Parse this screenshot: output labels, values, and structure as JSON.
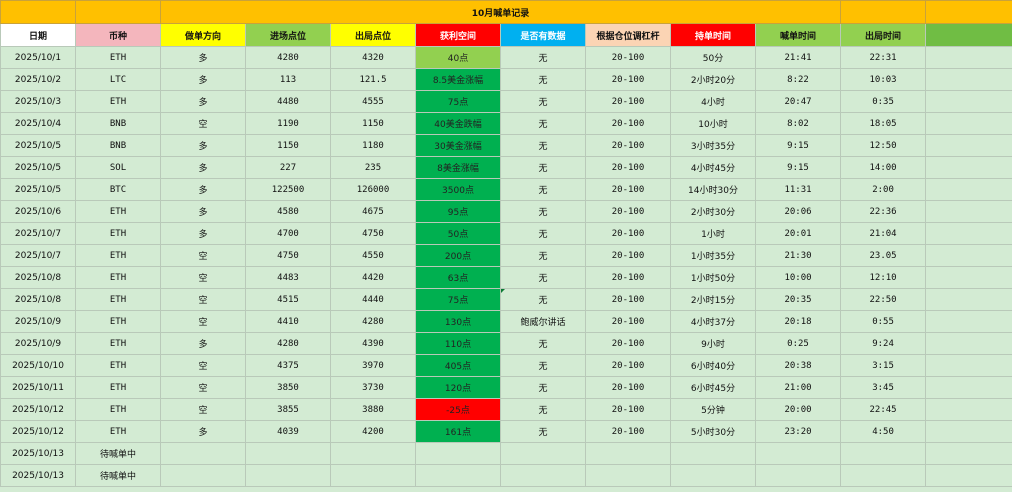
{
  "sheet": {
    "title": "10月喊单记录",
    "colors": {
      "page_bg": "#d3ebd3",
      "title_bg": "#ffc000",
      "profit_green": "#00b050",
      "profit_light_green": "#92d050",
      "loss_red": "#ff0000"
    },
    "headers": [
      {
        "label": "日期",
        "bg": "#ffffff",
        "color": "#111111"
      },
      {
        "label": "币种",
        "bg": "#f4b6bd",
        "color": "#111111"
      },
      {
        "label": "做单方向",
        "bg": "#ffff00",
        "color": "#111111"
      },
      {
        "label": "进场点位",
        "bg": "#92d050",
        "color": "#111111"
      },
      {
        "label": "出局点位",
        "bg": "#ffff00",
        "color": "#111111"
      },
      {
        "label": "获利空间",
        "bg": "#ff0000",
        "color": "#ffffff"
      },
      {
        "label": "是否有数据",
        "bg": "#00b0f0",
        "color": "#ffffff"
      },
      {
        "label": "根据仓位调杠杆",
        "bg": "#fbd4b4",
        "color": "#111111"
      },
      {
        "label": "持单时间",
        "bg": "#ff0000",
        "color": "#ffffff"
      },
      {
        "label": "喊单时间",
        "bg": "#92d050",
        "color": "#111111"
      },
      {
        "label": "出局时间",
        "bg": "#92d050",
        "color": "#111111"
      },
      {
        "label": "",
        "bg": "#70bd44",
        "color": "#111111"
      }
    ],
    "rows": [
      {
        "date": "2025/10/1",
        "coin": "ETH",
        "direction": "多",
        "entry": "4280",
        "exit": "4320",
        "profit": "40点",
        "profit_bg": "#92d050",
        "data": "无",
        "leverage": "20-100",
        "hold": "50分",
        "call_time": "21:41",
        "out_time": "22:31"
      },
      {
        "date": "2025/10/2",
        "coin": "LTC",
        "direction": "多",
        "entry": "113",
        "exit": "121.5",
        "profit": "8.5美金涨幅",
        "profit_bg": "#00b050",
        "data": "无",
        "leverage": "20-100",
        "hold": "2小时20分",
        "call_time": "8:22",
        "out_time": "10:03"
      },
      {
        "date": "2025/10/3",
        "coin": "ETH",
        "direction": "多",
        "entry": "4480",
        "exit": "4555",
        "profit": "75点",
        "profit_bg": "#00b050",
        "data": "无",
        "leverage": "20-100",
        "hold": "4小时",
        "call_time": "20:47",
        "out_time": "0:35"
      },
      {
        "date": "2025/10/4",
        "coin": "BNB",
        "direction": "空",
        "entry": "1190",
        "exit": "1150",
        "profit": "40美金跌幅",
        "profit_bg": "#00b050",
        "data": "无",
        "leverage": "20-100",
        "hold": "10小时",
        "call_time": "8:02",
        "out_time": "18:05"
      },
      {
        "date": "2025/10/5",
        "coin": "BNB",
        "direction": "多",
        "entry": "1150",
        "exit": "1180",
        "profit": "30美金涨幅",
        "profit_bg": "#00b050",
        "data": "无",
        "leverage": "20-100",
        "hold": "3小时35分",
        "call_time": "9:15",
        "out_time": "12:50"
      },
      {
        "date": "2025/10/5",
        "coin": "SOL",
        "direction": "多",
        "entry": "227",
        "exit": "235",
        "profit": "8美金涨幅",
        "profit_bg": "#00b050",
        "data": "无",
        "leverage": "20-100",
        "hold": "4小时45分",
        "call_time": "9:15",
        "out_time": "14:00"
      },
      {
        "date": "2025/10/5",
        "coin": "BTC",
        "direction": "多",
        "entry": "122500",
        "exit": "126000",
        "profit": "3500点",
        "profit_bg": "#00b050",
        "data": "无",
        "leverage": "20-100",
        "hold": "14小时30分",
        "call_time": "11:31",
        "out_time": "2:00"
      },
      {
        "date": "2025/10/6",
        "coin": "ETH",
        "direction": "多",
        "entry": "4580",
        "exit": "4675",
        "profit": "95点",
        "profit_bg": "#00b050",
        "data": "无",
        "leverage": "20-100",
        "hold": "2小时30分",
        "call_time": "20:06",
        "out_time": "22:36"
      },
      {
        "date": "2025/10/7",
        "coin": "ETH",
        "direction": "多",
        "entry": "4700",
        "exit": "4750",
        "profit": "50点",
        "profit_bg": "#00b050",
        "data": "无",
        "leverage": "20-100",
        "hold": "1小时",
        "call_time": "20:01",
        "out_time": "21:04"
      },
      {
        "date": "2025/10/7",
        "coin": "ETH",
        "direction": "空",
        "entry": "4750",
        "exit": "4550",
        "profit": "200点",
        "profit_bg": "#00b050",
        "data": "无",
        "leverage": "20-100",
        "hold": "1小时35分",
        "call_time": "21:30",
        "out_time": "23.05"
      },
      {
        "date": "2025/10/8",
        "coin": "ETH",
        "direction": "空",
        "entry": "4483",
        "exit": "4420",
        "profit": "63点",
        "profit_bg": "#00b050",
        "data": "无",
        "leverage": "20-100",
        "hold": "1小时50分",
        "call_time": "10:00",
        "out_time": "12:10"
      },
      {
        "date": "2025/10/8",
        "coin": "ETH",
        "direction": "空",
        "entry": "4515",
        "exit": "4440",
        "profit": "75点",
        "profit_bg": "#00b050",
        "data": "无",
        "leverage": "20-100",
        "hold": "2小时15分",
        "call_time": "20:35",
        "out_time": "22:50"
      },
      {
        "date": "2025/10/9",
        "coin": "ETH",
        "direction": "空",
        "entry": "4410",
        "exit": "4280",
        "profit": "130点",
        "profit_bg": "#00b050",
        "data": "鲍威尔讲话",
        "leverage": "20-100",
        "hold": "4小时37分",
        "call_time": "20:18",
        "out_time": "0:55"
      },
      {
        "date": "2025/10/9",
        "coin": "ETH",
        "direction": "多",
        "entry": "4280",
        "exit": "4390",
        "profit": "110点",
        "profit_bg": "#00b050",
        "data": "无",
        "leverage": "20-100",
        "hold": "9小时",
        "call_time": "0:25",
        "out_time": "9:24"
      },
      {
        "date": "2025/10/10",
        "coin": "ETH",
        "direction": "空",
        "entry": "4375",
        "exit": "3970",
        "profit": "405点",
        "profit_bg": "#00b050",
        "data": "无",
        "leverage": "20-100",
        "hold": "6小时40分",
        "call_time": "20:38",
        "out_time": "3:15"
      },
      {
        "date": "2025/10/11",
        "coin": "ETH",
        "direction": "空",
        "entry": "3850",
        "exit": "3730",
        "profit": "120点",
        "profit_bg": "#00b050",
        "data": "无",
        "leverage": "20-100",
        "hold": "6小时45分",
        "call_time": "21:00",
        "out_time": "3:45"
      },
      {
        "date": "2025/10/12",
        "coin": "ETH",
        "direction": "空",
        "entry": "3855",
        "exit": "3880",
        "profit": "-25点",
        "profit_bg": "#ff0000",
        "data": "无",
        "leverage": "20-100",
        "hold": "5分钟",
        "call_time": "20:00",
        "out_time": "22:45"
      },
      {
        "date": "2025/10/12",
        "coin": "ETH",
        "direction": "多",
        "entry": "4039",
        "exit": "4200",
        "profit": "161点",
        "profit_bg": "#00b050",
        "data": "无",
        "leverage": "20-100",
        "hold": "5小时30分",
        "call_time": "23:20",
        "out_time": "4:50"
      },
      {
        "date": "2025/10/13",
        "coin": "待喊单中",
        "direction": "",
        "entry": "",
        "exit": "",
        "profit": "",
        "profit_bg": "",
        "data": "",
        "leverage": "",
        "hold": "",
        "call_time": "",
        "out_time": ""
      },
      {
        "date": "2025/10/13",
        "coin": "待喊单中",
        "direction": "",
        "entry": "",
        "exit": "",
        "profit": "",
        "profit_bg": "",
        "data": "",
        "leverage": "",
        "hold": "",
        "call_time": "",
        "out_time": ""
      }
    ]
  }
}
